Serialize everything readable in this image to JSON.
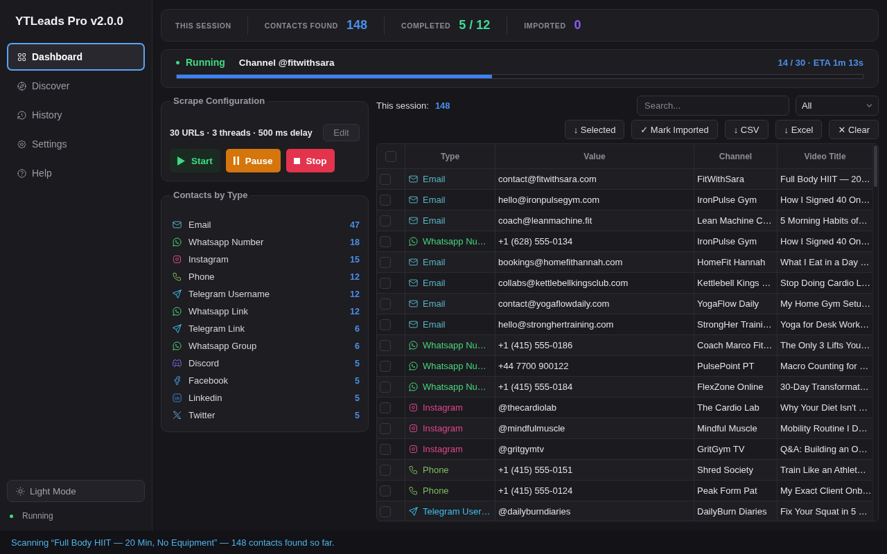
{
  "sidebar": {
    "title": "YTLeads Pro v2.0.0",
    "nav": [
      {
        "kind": "grid",
        "label": "Dashboard",
        "selected": true
      },
      {
        "kind": "compass",
        "label": "Discover",
        "selected": false
      },
      {
        "kind": "history",
        "label": "History",
        "selected": false
      },
      {
        "kind": "settings",
        "label": "Settings",
        "selected": false
      },
      {
        "kind": "help",
        "label": "Help",
        "selected": false
      }
    ],
    "theme_button": {
      "label": "Light Mode"
    },
    "status": {
      "label": "Running"
    }
  },
  "stats": {
    "session_label": "THIS SESSION",
    "items": [
      {
        "kind": "found",
        "label": "CONTACTS FOUND",
        "value": "148"
      },
      {
        "kind": "completed",
        "label": "COMPLETED",
        "value": "5 / 12"
      },
      {
        "kind": "imported",
        "label": "IMPORTED",
        "value": "0"
      }
    ]
  },
  "progress": {
    "status": "Running",
    "channel": "Channel @fitwithsara",
    "count": "14 / 30 · ETA 1m 13s",
    "level": 0.46
  },
  "config": {
    "legend": "Scrape Configuration",
    "summary": "30 URLs · 3 threads · 500 ms delay",
    "edit_label": "Edit",
    "buttons": [
      {
        "kind": "start",
        "label": "Start"
      },
      {
        "kind": "pause",
        "label": "Pause"
      },
      {
        "kind": "stop",
        "label": "Stop"
      }
    ]
  },
  "contacts_by_type": {
    "legend": "Contacts by Type",
    "items": [
      {
        "kind": "email",
        "label": "Email",
        "count": "47"
      },
      {
        "kind": "whatsapp",
        "label": "Whatsapp Number",
        "count": "18"
      },
      {
        "kind": "instagram",
        "label": "Instagram",
        "count": "15"
      },
      {
        "kind": "phone",
        "label": "Phone",
        "count": "12"
      },
      {
        "kind": "telegram",
        "label": "Telegram Username",
        "count": "12"
      },
      {
        "kind": "whatsapp",
        "label": "Whatsapp Link",
        "count": "12"
      },
      {
        "kind": "telegram",
        "label": "Telegram Link",
        "count": "6"
      },
      {
        "kind": "whatsapp",
        "label": "Whatsapp Group",
        "count": "6"
      },
      {
        "kind": "discord",
        "label": "Discord",
        "count": "5"
      },
      {
        "kind": "facebook",
        "label": "Facebook",
        "count": "5"
      },
      {
        "kind": "linkedin",
        "label": "Linkedin",
        "count": "5"
      },
      {
        "kind": "twitter",
        "label": "Twitter",
        "count": "5"
      }
    ]
  },
  "results": {
    "session_label": "This session:",
    "session_count": "148",
    "search": {
      "placeholder": "Search..."
    },
    "filter": {
      "value": "All"
    },
    "actions": [
      {
        "label": "↓ Selected"
      },
      {
        "label": "✓ Mark Imported"
      },
      {
        "label": "↓ CSV"
      },
      {
        "label": "↓ Excel"
      },
      {
        "label": "✕ Clear"
      }
    ]
  },
  "table": {
    "select_all_checked": false,
    "columns": [
      "Type",
      "Value",
      "Channel",
      "Video Title"
    ],
    "rows": [
      {
        "checked": false,
        "kind": "email",
        "type": "Email",
        "value": "contact@fitwithsara.com",
        "channel": "FitWithSara",
        "video_title": "Full Body HIIT — 20…"
      },
      {
        "checked": false,
        "kind": "email",
        "type": "Email",
        "value": "hello@ironpulsegym.com",
        "channel": "IronPulse Gym",
        "video_title": "How I Signed 40 On…"
      },
      {
        "checked": false,
        "kind": "email",
        "type": "Email",
        "value": "coach@leanmachine.fit",
        "channel": "Lean Machine C…",
        "video_title": "5 Morning Habits of…"
      },
      {
        "checked": false,
        "kind": "whatsapp",
        "type": "Whatsapp Nu…",
        "value": "+1 (628) 555-0134",
        "channel": "IronPulse Gym",
        "video_title": "How I Signed 40 On…"
      },
      {
        "checked": false,
        "kind": "email",
        "type": "Email",
        "value": "bookings@homefithannah.com",
        "channel": "HomeFit Hannah",
        "video_title": "What I Eat in a Day …"
      },
      {
        "checked": false,
        "kind": "email",
        "type": "Email",
        "value": "collabs@kettlebellkingsclub.com",
        "channel": "Kettlebell Kings …",
        "video_title": "Stop Doing Cardio L…"
      },
      {
        "checked": false,
        "kind": "email",
        "type": "Email",
        "value": "contact@yogaflowdaily.com",
        "channel": "YogaFlow Daily",
        "video_title": "My Home Gym Setu…"
      },
      {
        "checked": false,
        "kind": "email",
        "type": "Email",
        "value": "hello@stronghertraining.com",
        "channel": "StrongHer Traini…",
        "video_title": "Yoga for Desk Work…"
      },
      {
        "checked": false,
        "kind": "whatsapp",
        "type": "Whatsapp Nu…",
        "value": "+1 (415) 555-0186",
        "channel": "Coach Marco Fit…",
        "video_title": "The Only 3 Lifts You…"
      },
      {
        "checked": false,
        "kind": "whatsapp",
        "type": "Whatsapp Nu…",
        "value": "+44 7700 900122",
        "channel": "PulsePoint PT",
        "video_title": "Macro Counting for …"
      },
      {
        "checked": false,
        "kind": "whatsapp",
        "type": "Whatsapp Nu…",
        "value": "+1 (415) 555-0184",
        "channel": "FlexZone Online",
        "video_title": "30-Day Transformat…"
      },
      {
        "checked": false,
        "kind": "instagram",
        "type": "Instagram",
        "value": "@thecardiolab",
        "channel": "The Cardio Lab",
        "video_title": "Why Your Diet Isn't …"
      },
      {
        "checked": false,
        "kind": "instagram",
        "type": "Instagram",
        "value": "@mindfulmuscle",
        "channel": "Mindful Muscle",
        "video_title": "Mobility Routine I D…"
      },
      {
        "checked": false,
        "kind": "instagram",
        "type": "Instagram",
        "value": "@gritgymtv",
        "channel": "GritGym TV",
        "video_title": "Q&A: Building an O…"
      },
      {
        "checked": false,
        "kind": "phone",
        "type": "Phone",
        "value": "+1 (415) 555-0151",
        "channel": "Shred Society",
        "video_title": "Train Like an Athlet…"
      },
      {
        "checked": false,
        "kind": "phone",
        "type": "Phone",
        "value": "+1 (415) 555-0124",
        "channel": "Peak Form Pat",
        "video_title": "My Exact Client Onb…"
      },
      {
        "checked": false,
        "kind": "telegram",
        "type": "Telegram User…",
        "value": "@dailyburndiaries",
        "channel": "DailyBurn Diaries",
        "video_title": "Fix Your Squat in 5 …"
      }
    ]
  },
  "status_bar": {
    "text": "Scanning “Full Body HIIT — 20 Min, No Equipment” — 148 contacts found so far."
  }
}
